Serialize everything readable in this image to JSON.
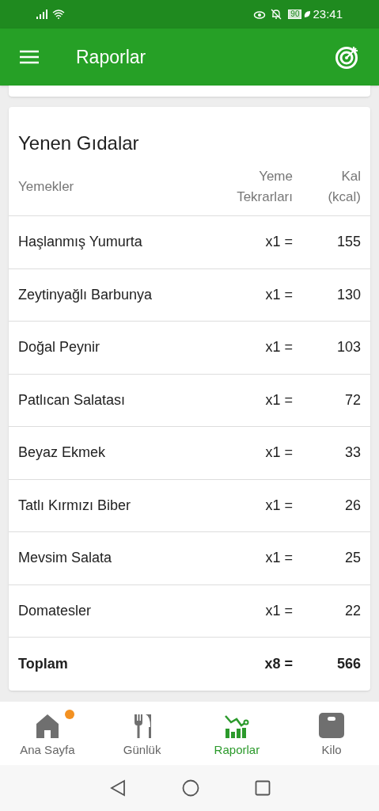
{
  "status_bar": {
    "battery": "90",
    "time": "23:41"
  },
  "app_bar": {
    "title": "Raporlar"
  },
  "foods_card": {
    "title": "Yenen Gıdalar",
    "columns": [
      {
        "lines": [
          "Yemekler"
        ]
      },
      {
        "lines": [
          "Yeme",
          "Tekrarları"
        ]
      },
      {
        "lines": [
          "Kal",
          "(kcal)"
        ]
      }
    ],
    "rows": [
      {
        "kind": "item",
        "name": "Haşlanmış Yumurta",
        "count": "x1 =",
        "kcal": "155"
      },
      {
        "kind": "item",
        "name": "Zeytinyağlı Barbunya",
        "count": "x1 =",
        "kcal": "130"
      },
      {
        "kind": "item",
        "name": "Doğal Peynir",
        "count": "x1 =",
        "kcal": "103"
      },
      {
        "kind": "item",
        "name": "Patlıcan Salatası",
        "count": "x1 =",
        "kcal": "72"
      },
      {
        "kind": "item",
        "name": "Beyaz Ekmek",
        "count": "x1 =",
        "kcal": "33"
      },
      {
        "kind": "item",
        "name": "Tatlı Kırmızı Biber",
        "count": "x1 =",
        "kcal": "26"
      },
      {
        "kind": "item",
        "name": "Mevsim Salata",
        "count": "x1 =",
        "kcal": "25"
      },
      {
        "kind": "item",
        "name": "Domatesler",
        "count": "x1 =",
        "kcal": "22"
      },
      {
        "kind": "total",
        "name": "Toplam",
        "count": "x8 =",
        "kcal": "566"
      }
    ]
  },
  "bottom_nav": [
    {
      "kind": "home",
      "label": "Ana Sayfa",
      "selected": false,
      "badge": true
    },
    {
      "kind": "diary",
      "label": "Günlük",
      "selected": false,
      "badge": false
    },
    {
      "kind": "reports",
      "label": "Raporlar",
      "selected": true,
      "badge": false
    },
    {
      "kind": "weight",
      "label": "Kilo",
      "selected": false,
      "badge": false
    }
  ]
}
